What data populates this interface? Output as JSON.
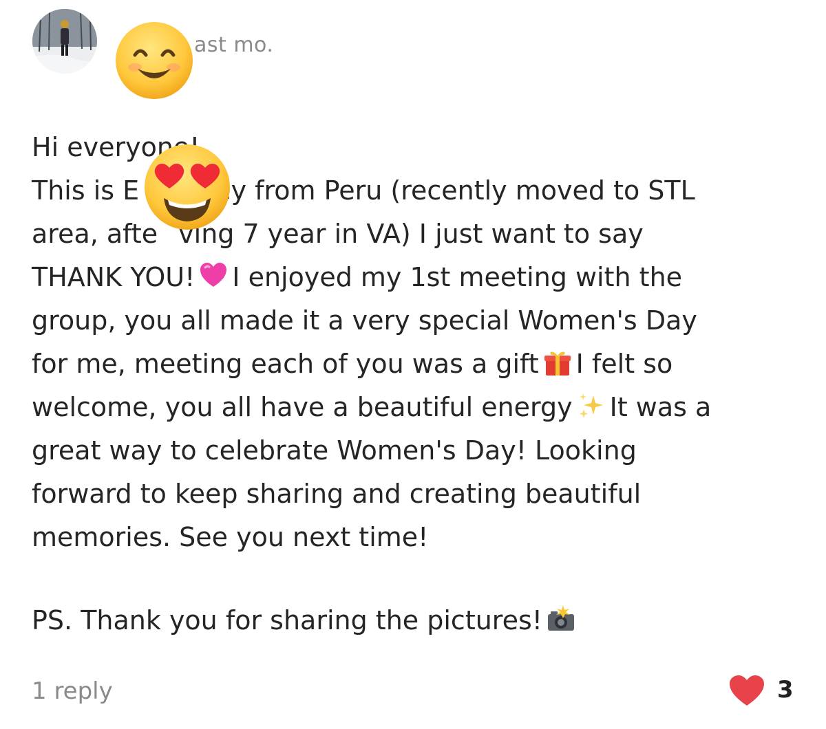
{
  "post": {
    "timestamp": "ast mo.",
    "lines": [
      "Hi everyone!",
      "This is E",
      "ey from Peru (recently moved to STL",
      "area, afte",
      "ving 7 year in VA) I just want to say",
      "THANK YOU!",
      "I enjoyed my 1st meeting with the",
      "group, you all made it a very special Women's Day",
      "for me, meeting each of you was a gift",
      "I felt so",
      "welcome, you all have a beautiful energy",
      "It was a",
      "great way to celebrate Women's Day! Looking",
      "forward to keep sharing and creating beautiful",
      "memories. See you next time!",
      "PS. Thank you for sharing the pictures!"
    ]
  },
  "overlays": {
    "smiling_emoji": "smiling-face-icon",
    "heart_eyes_emoji": "heart-eyes-icon"
  },
  "icons": {
    "pink_heart": "pink-heart-icon",
    "gift": "gift-icon",
    "sparkles": "sparkles-icon",
    "camera_flash": "camera-flash-icon"
  },
  "footer": {
    "replies": "1 reply",
    "likes": "3"
  },
  "colors": {
    "text": "#252525",
    "muted": "#8a8a8a",
    "like_heart": "#e8434a"
  }
}
